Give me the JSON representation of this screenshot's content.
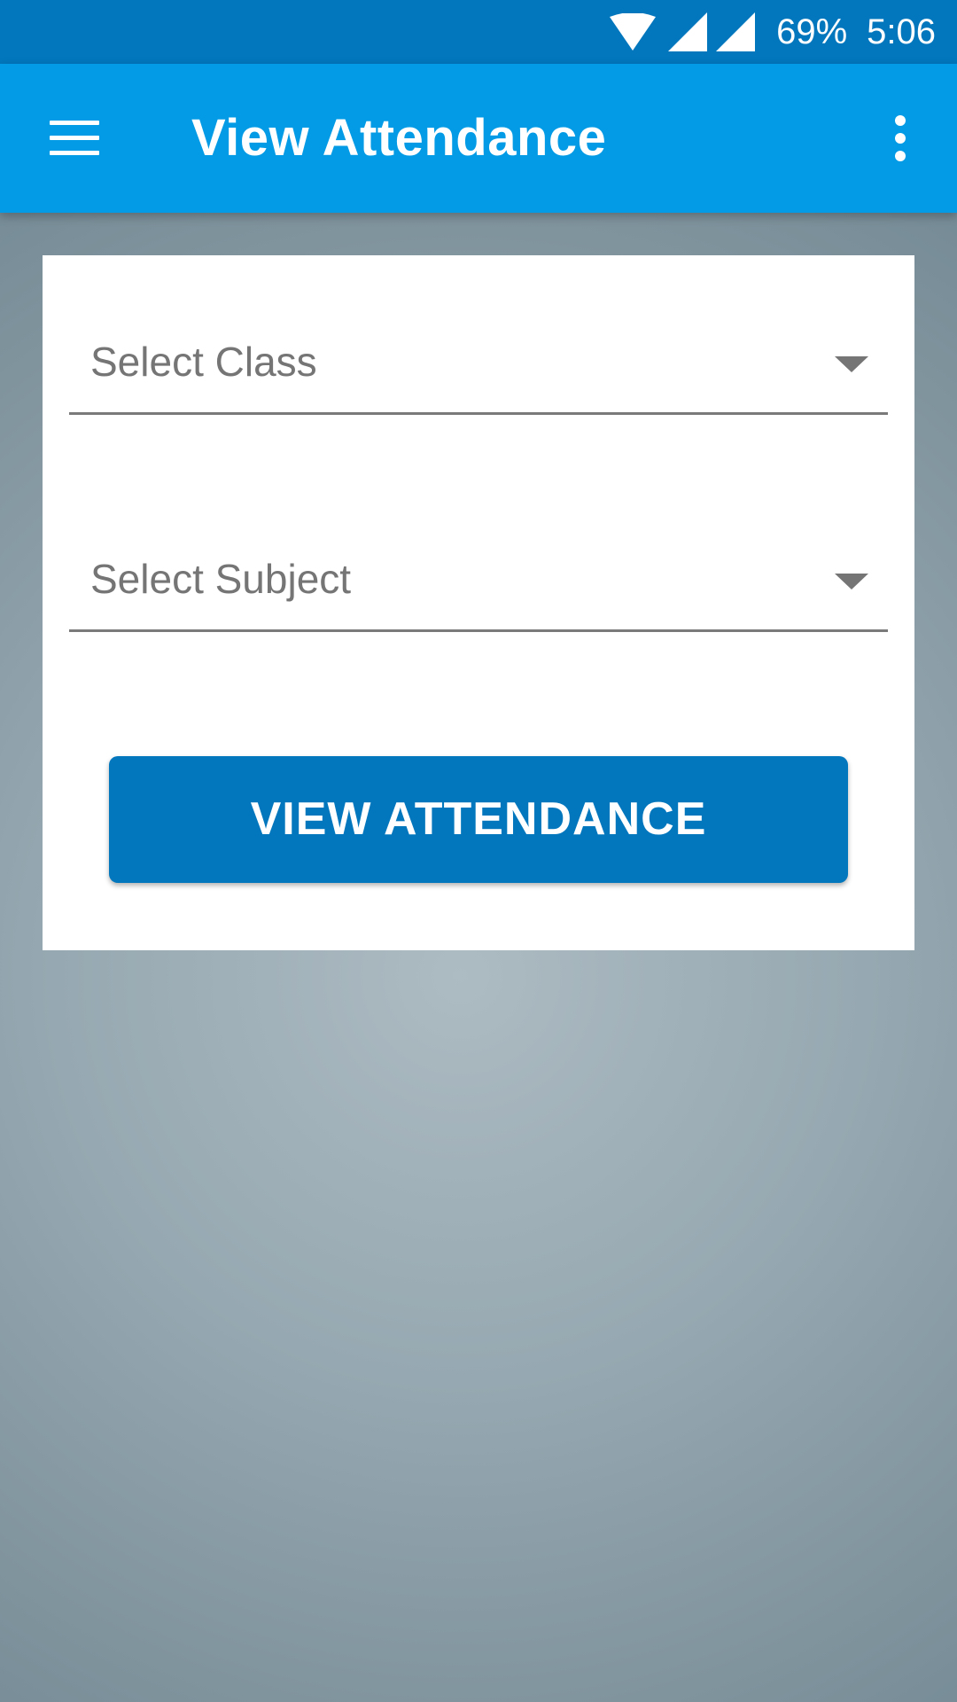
{
  "status_bar": {
    "battery": "69%",
    "time": "5:06",
    "icons": [
      "wifi-icon",
      "signal-icon",
      "signal-icon"
    ]
  },
  "app_bar": {
    "title": "View Attendance",
    "menu_icon": "hamburger-menu-icon",
    "more_icon": "more-vertical-icon",
    "background_color": "#039be5"
  },
  "form": {
    "class_spinner": {
      "label": "Select Class"
    },
    "subject_spinner": {
      "label": "Select Subject"
    },
    "submit_button": {
      "label": "VIEW ATTENDANCE",
      "color": "#0277bd"
    }
  },
  "colors": {
    "status_bar": "#0277bd",
    "app_bar": "#039be5",
    "button": "#0277bd",
    "card": "#ffffff"
  }
}
